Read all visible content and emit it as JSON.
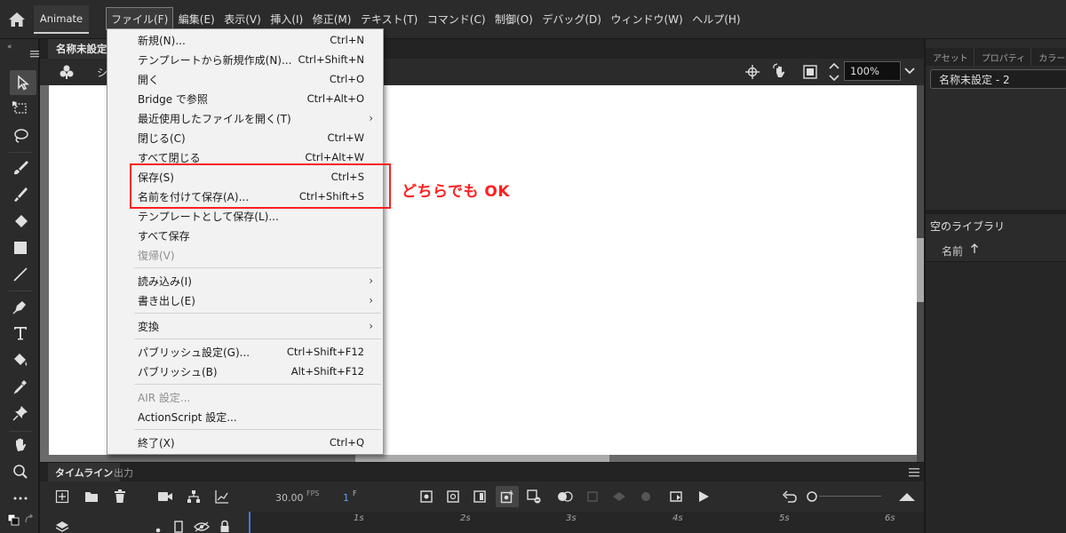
{
  "app": {
    "tab_label": "Animate",
    "menus": [
      "ファイル(F)",
      "編集(E)",
      "表示(V)",
      "挿入(I)",
      "修正(M)",
      "テキスト(T)",
      "コマンド(C)",
      "制御(O)",
      "デバッグ(D)",
      "ウィンドウ(W)",
      "ヘルプ(H)"
    ],
    "active_menu": "ファイル(F)"
  },
  "document": {
    "tab_label": "名称未設定",
    "scene_label": "シ",
    "zoom": "100%"
  },
  "file_menu": {
    "items": [
      {
        "label": "新規(N)...",
        "shortcut": "Ctrl+N"
      },
      {
        "label": "テンプレートから新規作成(N)...",
        "shortcut": "Ctrl+Shift+N"
      },
      {
        "label": "開く",
        "shortcut": "Ctrl+O"
      },
      {
        "label": "Bridge で参照",
        "shortcut": "Ctrl+Alt+O"
      },
      {
        "label": "最近使用したファイルを開く(T)",
        "shortcut": ""
      },
      {
        "label": "閉じる(C)",
        "shortcut": "Ctrl+W"
      },
      {
        "label": "すべて閉じる",
        "shortcut": "Ctrl+Alt+W"
      },
      {
        "label": "保存(S)",
        "shortcut": "Ctrl+S"
      },
      {
        "label": "名前を付けて保存(A)...",
        "shortcut": "Ctrl+Shift+S"
      },
      {
        "label": "テンプレートとして保存(L)...",
        "shortcut": ""
      },
      {
        "label": "すべて保存",
        "shortcut": ""
      },
      {
        "label": "復帰(V)",
        "shortcut": ""
      },
      {
        "label": "読み込み(I)",
        "shortcut": ""
      },
      {
        "label": "書き出し(E)",
        "shortcut": ""
      },
      {
        "label": "変換",
        "shortcut": ""
      },
      {
        "label": "パブリッシュ設定(G)...",
        "shortcut": "Ctrl+Shift+F12"
      },
      {
        "label": "パブリッシュ(B)",
        "shortcut": "Alt+Shift+F12"
      },
      {
        "label": "AIR 設定...",
        "shortcut": ""
      },
      {
        "label": "ActionScript 設定...",
        "shortcut": ""
      },
      {
        "label": "終了(X)",
        "shortcut": "Ctrl+Q"
      }
    ]
  },
  "annotation": {
    "text": "どちらでも OK",
    "color": "#ff1f1f"
  },
  "timeline": {
    "tab_label": "タイムライン",
    "output_tab_label": "出力",
    "fps": "30.00",
    "fps_label": "FPS",
    "frame": "1",
    "frame_label": "F",
    "seconds": [
      "1s",
      "2s",
      "3s",
      "4s",
      "5s",
      "6s"
    ]
  },
  "right_panel": {
    "tabs": [
      "アセット",
      "プロパティ",
      "カラー"
    ],
    "symbol_name": "名称未設定 - 2",
    "library_title": "空のライブラリ",
    "library_column": "名前"
  },
  "colors": {
    "accent": "#3d7be0",
    "annotation": "#ff1f1f",
    "menu_bg": "#f2f2f2",
    "chrome": "#2b2b2b"
  }
}
